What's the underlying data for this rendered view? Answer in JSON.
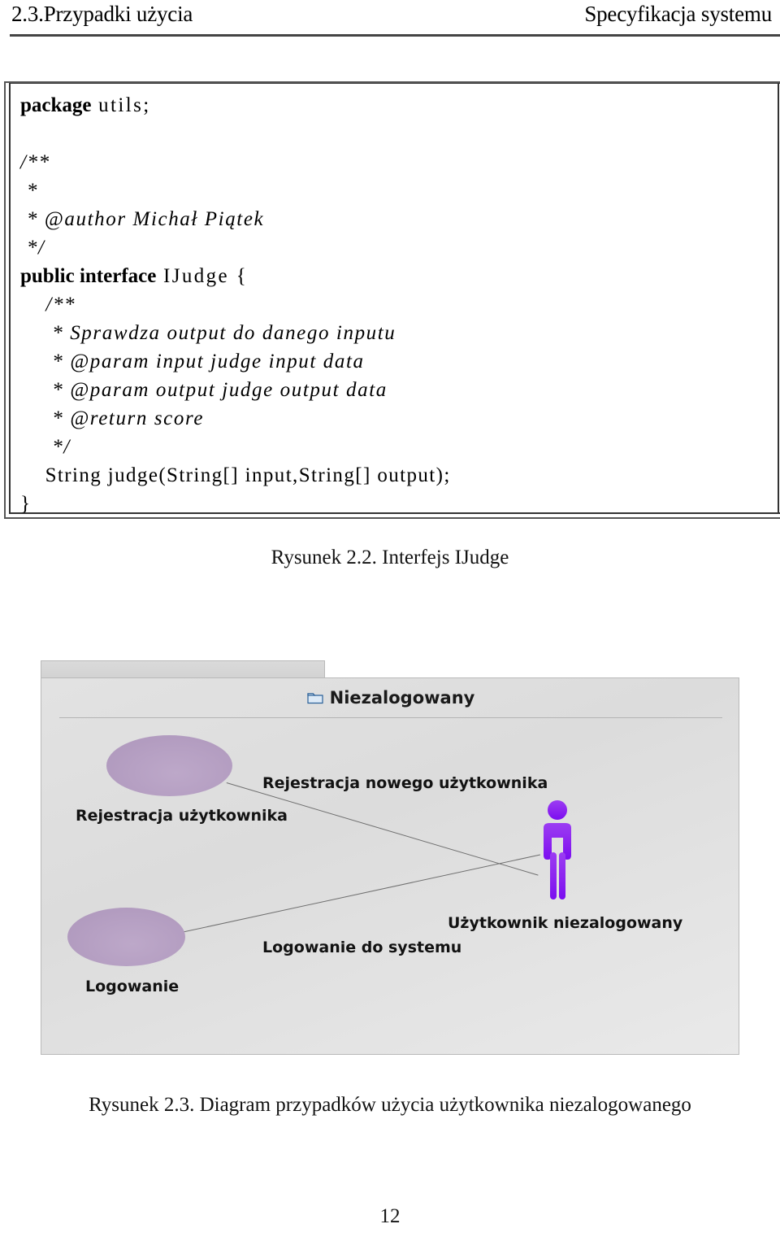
{
  "header": {
    "left": "2.3.Przypadki użycia",
    "right": "Specyfikacja systemu"
  },
  "code_listing": {
    "language": "Java",
    "lines": [
      {
        "tokens": [
          {
            "t": "kw",
            "s": "package"
          },
          {
            "t": "id",
            "s": " utils;"
          }
        ]
      },
      {
        "tokens": []
      },
      {
        "tokens": [
          {
            "t": "cm",
            "s": "/**"
          }
        ]
      },
      {
        "tokens": [
          {
            "t": "cm",
            "s": " *"
          }
        ]
      },
      {
        "tokens": [
          {
            "t": "cm",
            "s": " * @author Michał Piątek"
          }
        ]
      },
      {
        "tokens": [
          {
            "t": "cm",
            "s": " */"
          }
        ]
      },
      {
        "tokens": [
          {
            "t": "kw",
            "s": "public interface"
          },
          {
            "t": "id",
            "s": " IJudge {"
          }
        ]
      },
      {
        "tokens": [
          {
            "t": "cm",
            "s": "    /**"
          }
        ]
      },
      {
        "tokens": [
          {
            "t": "cm",
            "s": "     * Sprawdza output do danego inputu"
          }
        ]
      },
      {
        "tokens": [
          {
            "t": "cm",
            "s": "     * @param input judge input data"
          }
        ]
      },
      {
        "tokens": [
          {
            "t": "cm",
            "s": "     * @param output judge output data"
          }
        ]
      },
      {
        "tokens": [
          {
            "t": "cm",
            "s": "     * @return score"
          }
        ]
      },
      {
        "tokens": [
          {
            "t": "cm",
            "s": "     */"
          }
        ]
      },
      {
        "tokens": [
          {
            "t": "pn",
            "s": "    String judge(String[] input,String[] output);"
          }
        ]
      },
      {
        "tokens": [
          {
            "t": "pn",
            "s": "}"
          }
        ]
      }
    ]
  },
  "figure_2_2": {
    "caption": "Rysunek 2.2. Interfejs IJudge"
  },
  "figure_2_3": {
    "caption": "Rysunek 2.3. Diagram przypadków użycia użytkownika niezalogowanego",
    "diagram": {
      "type": "uml-use-case",
      "package_title": "Niezalogowany",
      "package_icon": "folder-icon",
      "use_cases": [
        {
          "id": "rejestracja",
          "label": "Rejestracja użytkownika"
        },
        {
          "id": "logowanie",
          "label": "Logowanie"
        }
      ],
      "actors": [
        {
          "id": "uzytkownik-niezalogowany",
          "label": "Użytkownik niezalogowany"
        }
      ],
      "associations": [
        {
          "from": "rejestracja",
          "to": "uzytkownik-niezalogowany",
          "label": "Rejestracja nowego użytkownika"
        },
        {
          "from": "logowanie",
          "to": "uzytkownik-niezalogowany",
          "label": "Logowanie do systemu"
        }
      ],
      "colors": {
        "use_case_fill": "#b6a0c3",
        "actor_fill": "#8c1ff0",
        "canvas": "#e0e0e0",
        "association_line": "#6f6f6f"
      }
    }
  },
  "footer": {
    "page_number": "12"
  }
}
